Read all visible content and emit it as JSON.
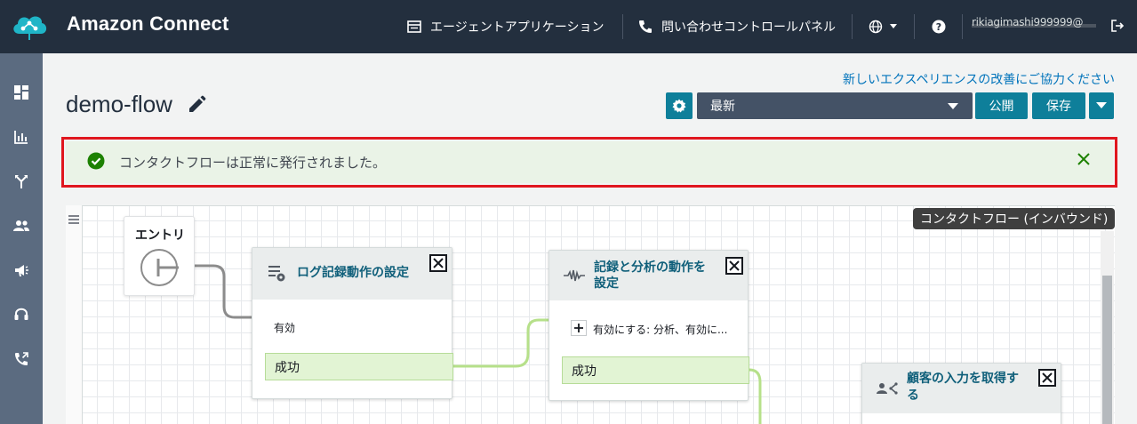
{
  "app": {
    "title": "Amazon Connect"
  },
  "topnav": {
    "agent_app": "エージェントアプリケーション",
    "contact_control_panel": "問い合わせコントロールパネル",
    "user": "rikiagimashi999999@",
    "icons": [
      "window-icon",
      "phone-icon",
      "globe-icon",
      "help-icon",
      "logout-icon"
    ]
  },
  "sidebar": {
    "items": [
      {
        "icon": "dashboard-icon"
      },
      {
        "icon": "analytics-icon"
      },
      {
        "icon": "routing-icon"
      },
      {
        "icon": "users-icon"
      },
      {
        "icon": "campaigns-icon"
      },
      {
        "icon": "headset-icon"
      },
      {
        "icon": "phone-forward-icon"
      }
    ]
  },
  "header": {
    "feedback_link": "新しいエクスペリエンスの改善にご協力ください",
    "flow_name": "demo-flow",
    "version_select": "最新",
    "publish_label": "公開",
    "save_label": "保存"
  },
  "alert": {
    "message": "コンタクトフローは正常に発行されました。",
    "status": "success",
    "color": "#1d8102"
  },
  "canvas": {
    "flow_type_badge": "コンタクトフロー (インバウンド)",
    "entry_label": "エントリ",
    "blocks": [
      {
        "title": "ログ記録動作の設定",
        "input_label": "有効",
        "branch_label": "成功"
      },
      {
        "title_line1": "記録と分析の動作を",
        "title_line2": "設定",
        "input_label": "有効にする: 分析、有効に...",
        "branch_label": "成功"
      },
      {
        "title_line1": "顧客の入力を取得す",
        "title_line2": "る"
      }
    ]
  },
  "colors": {
    "topbar": "#232f3e",
    "sidebar": "#5b6b80",
    "accent": "#0e7f9a",
    "alert_outline": "#e0161e",
    "branch_fill": "#e2f4d4"
  }
}
